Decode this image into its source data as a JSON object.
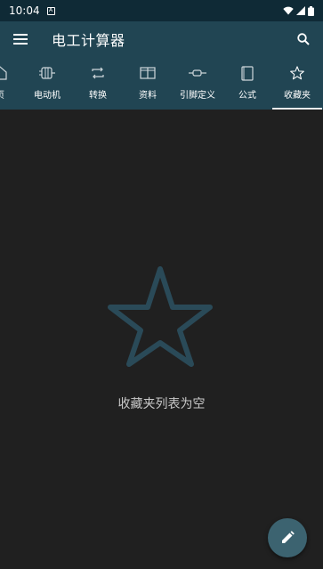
{
  "status_bar": {
    "time": "10:04",
    "notification_icon": "a-icon"
  },
  "app_bar": {
    "title": "电工计算器"
  },
  "tabs": [
    {
      "label": "页",
      "icon": "home-icon"
    },
    {
      "label": "电动机",
      "icon": "motor-icon"
    },
    {
      "label": "转换",
      "icon": "convert-icon"
    },
    {
      "label": "资料",
      "icon": "book-open-icon"
    },
    {
      "label": "引脚定义",
      "icon": "pin-icon"
    },
    {
      "label": "公式",
      "icon": "formula-book-icon"
    },
    {
      "label": "收藏夹",
      "icon": "star-icon",
      "active": true
    }
  ],
  "empty_state": {
    "message": "收藏夹列表为空"
  },
  "colors": {
    "status_bar": "#0f2a36",
    "app_bar": "#214553",
    "background": "#202020",
    "star_outline": "#2a4a58",
    "fab": "#3c6370"
  }
}
